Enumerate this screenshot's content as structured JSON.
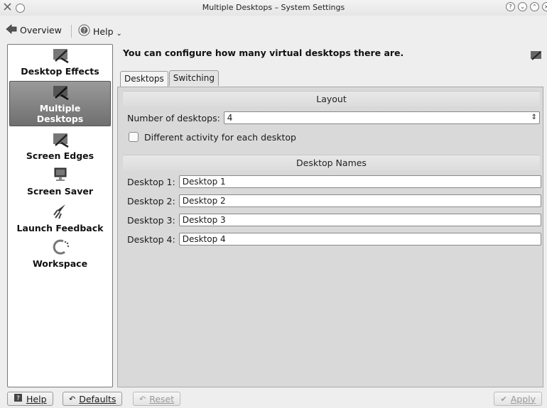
{
  "window": {
    "title": "Multiple Desktops – System Settings"
  },
  "toolbar": {
    "overview_label": "Overview",
    "help_label": "Help"
  },
  "sidebar": {
    "items": [
      {
        "label": "Desktop Effects",
        "icon": "desktop-effects-icon"
      },
      {
        "label": "Multiple",
        "label2": "Desktops",
        "icon": "multiple-desktops-icon",
        "selected": true
      },
      {
        "label": "Screen Edges",
        "icon": "screen-edges-icon"
      },
      {
        "label": "Screen Saver",
        "icon": "monitor-icon"
      },
      {
        "label": "Launch Feedback",
        "icon": "rocket-icon"
      },
      {
        "label": "Workspace",
        "icon": "workspace-icon"
      }
    ]
  },
  "main": {
    "headline": "You can configure how many virtual desktops there are.",
    "tabs": [
      {
        "label": "Desktops",
        "active": true
      },
      {
        "label": "Switching",
        "active": false
      }
    ],
    "layout": {
      "title": "Layout",
      "num_desktops_label": "Number of desktops:",
      "num_desktops_value": "4",
      "activity_label": "Different activity for each desktop",
      "activity_checked": false
    },
    "names": {
      "title": "Desktop Names",
      "rows": [
        {
          "label": "Desktop 1:",
          "value": "Desktop 1"
        },
        {
          "label": "Desktop 2:",
          "value": "Desktop 2"
        },
        {
          "label": "Desktop 3:",
          "value": "Desktop 3"
        },
        {
          "label": "Desktop 4:",
          "value": "Desktop 4"
        }
      ]
    }
  },
  "bottom": {
    "help_label": "Help",
    "defaults_label": "Defaults",
    "reset_label": "Reset",
    "apply_label": "Apply"
  }
}
